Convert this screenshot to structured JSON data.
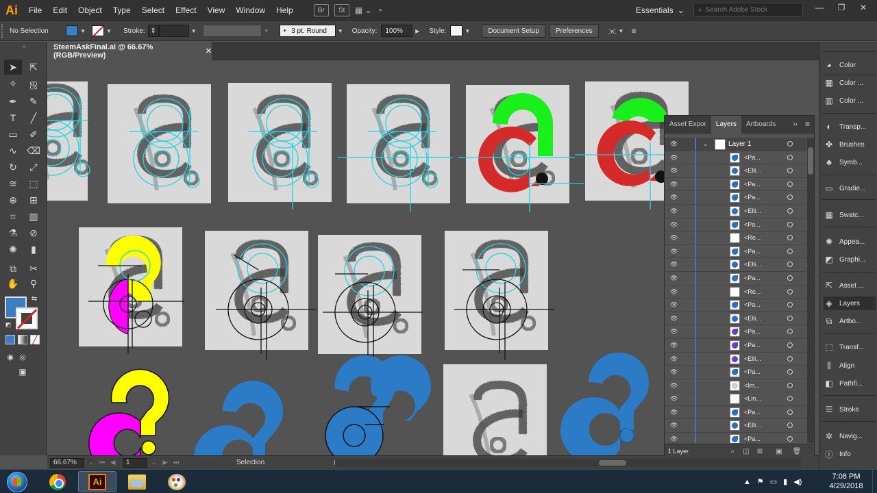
{
  "app": {
    "logo_text": "Ai",
    "menus": [
      "File",
      "Edit",
      "Object",
      "Type",
      "Select",
      "Effect",
      "View",
      "Window",
      "Help"
    ],
    "bridge_label": "Br",
    "stock_label": "St",
    "workspace": "Essentials",
    "search_placeholder": "Search Adobe Stock"
  },
  "controlbar": {
    "selection_status": "No Selection",
    "fill_color": "#3b7ec6",
    "stroke_label": "Stroke:",
    "brush_value": "3 pt. Round",
    "opacity_label": "Opacity:",
    "opacity_value": "100%",
    "style_label": "Style:",
    "document_setup": "Document Setup",
    "preferences": "Preferences"
  },
  "document": {
    "tab_title": "SteemAskFinal.ai @ 66.67% (RGB/Preview)",
    "close_glyph": "✕"
  },
  "statusbar": {
    "zoom": "66.67%",
    "artboard": "1",
    "tool_status": "Selection"
  },
  "layers_panel": {
    "tabs": [
      "Asset Expor",
      "Layers",
      "Artboards"
    ],
    "active_tab": "Layers",
    "layer_name": "Layer 1",
    "items": [
      "<Pa...",
      "<Elli...",
      "<Pa...",
      "<Pa...",
      "<Elli...",
      "<Pa...",
      "<Re...",
      "<Pa...",
      "<Elli...",
      "<Pa...",
      "<Re...",
      "<Pa...",
      "<Elli...",
      "<Pa...",
      "<Pa...",
      "<Elli...",
      "<Pa...",
      "<Im...",
      "<Lin...",
      "<Pa...",
      "<Elli...",
      "<Pa..."
    ],
    "footer_count": "1 Layer"
  },
  "dock": {
    "items": [
      "Color",
      "Color ...",
      "Color ...",
      "Transp...",
      "Brushes",
      "Symb...",
      "Gradie...",
      "Swatc...",
      "Appea...",
      "Graphi...",
      "Asset ...",
      "Layers",
      "Artbo...",
      "Transf...",
      "Align",
      "Pathfi...",
      "Stroke",
      "Navig...",
      "Info"
    ],
    "active": "Layers"
  },
  "taskbar": {
    "time": "7:08 PM",
    "date": "4/29/2018"
  },
  "colors": {
    "accent_blue": "#3b7ec6",
    "guide_cyan": "#22d3e6",
    "green": "#19f019",
    "red": "#d42a2a",
    "yellow": "#ffff00",
    "magenta": "#ff00ff"
  }
}
